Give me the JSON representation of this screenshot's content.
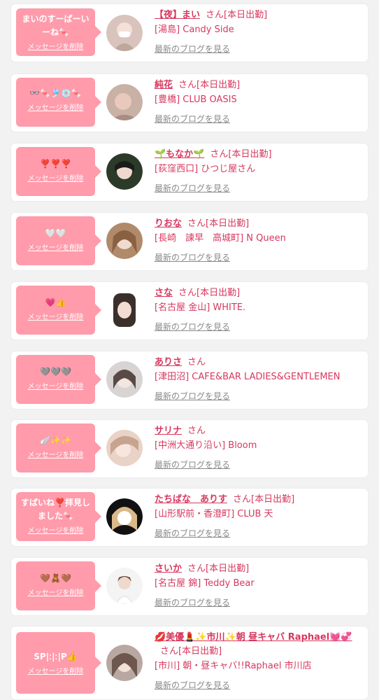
{
  "colors": {
    "accent": "#d7385e",
    "bubble": "#ff9bab",
    "card_bg": "#ffffff",
    "page_bg": "#f2f2f2",
    "link_grey": "#8a8a8a"
  },
  "items": [
    {
      "message": "まいのすーぱーいーね🍬",
      "delete_label": "メッセージを削除",
      "name": "【夜】まい",
      "honorific": "さん",
      "status": "[本日出勤]",
      "shop": "[湯島] Candy Side",
      "blog_label": "最新のブログを見る",
      "avatar_icon": "girl-avatar"
    },
    {
      "message": "👓🍬🎐💿🍬",
      "delete_label": "メッセージを削除",
      "name": "純花",
      "honorific": "さん",
      "status": "[本日出勤]",
      "shop": "[豊橋] CLUB OASIS",
      "blog_label": "最新のブログを見る",
      "avatar_icon": "girl-avatar"
    },
    {
      "message": "❣️❣️❣️",
      "delete_label": "メッセージを削除",
      "name": "🌱もなか🌱",
      "honorific": "さん",
      "status": "[本日出勤]",
      "shop": "[荻窪西口] ひつじ屋さん",
      "blog_label": "最新のブログを見る",
      "avatar_icon": "girl-avatar"
    },
    {
      "message": "🤍🤍",
      "delete_label": "メッセージを削除",
      "name": "りおな",
      "honorific": "さん",
      "status": "[本日出勤]",
      "shop": "[長崎　諫早　高城町] N Queen",
      "blog_label": "最新のブログを見る",
      "avatar_icon": "girl-avatar"
    },
    {
      "message": "💗👍",
      "delete_label": "メッセージを削除",
      "name": "さな",
      "honorific": "さん",
      "status": "[本日出勤]",
      "shop": "[名古屋 金山] WHITE.",
      "blog_label": "最新のブログを見る",
      "avatar_icon": "girl-avatar"
    },
    {
      "message": "🩶🩶🩶",
      "delete_label": "メッセージを削除",
      "name": "ありさ",
      "honorific": "さん",
      "status": "",
      "shop": "[津田沼] CAFE&BAR LADIES&GENTLEMEN",
      "blog_label": "最新のブログを見る",
      "avatar_icon": "girl-avatar"
    },
    {
      "message": "🪽✨✨",
      "delete_label": "メッセージを削除",
      "name": "サリナ",
      "honorific": "さん",
      "status": "",
      "shop": "[中洲大通り沿い] Bloom",
      "blog_label": "最新のブログを見る",
      "avatar_icon": "girl-avatar"
    },
    {
      "message": "すばいね❣️拝見しました🍬",
      "delete_label": "メッセージを削除",
      "name": "たちばな　ありす",
      "honorific": "さん",
      "status": "[本日出勤]",
      "shop": "[山形駅前・香澄町] CLUB 天",
      "blog_label": "最新のブログを見る",
      "avatar_icon": "girl-avatar"
    },
    {
      "message": "🤎🧸🤎",
      "delete_label": "メッセージを削除",
      "name": "さいか",
      "honorific": "さん",
      "status": "[本日出勤]",
      "shop": "[名古屋 錦] Teddy Bear",
      "blog_label": "最新のブログを見る",
      "avatar_icon": "girl-avatar"
    },
    {
      "message": "SP|ː|ː|P👍",
      "delete_label": "メッセージを削除",
      "name": "💋美優💄✨市川✨朝 昼キャバ Raphael💓💞",
      "honorific": "さん",
      "status": "[本日出勤]",
      "shop": "[市川] 朝・昼キャバ!!Raphael 市川店",
      "blog_label": "最新のブログを見る",
      "avatar_icon": "girl-avatar"
    }
  ]
}
